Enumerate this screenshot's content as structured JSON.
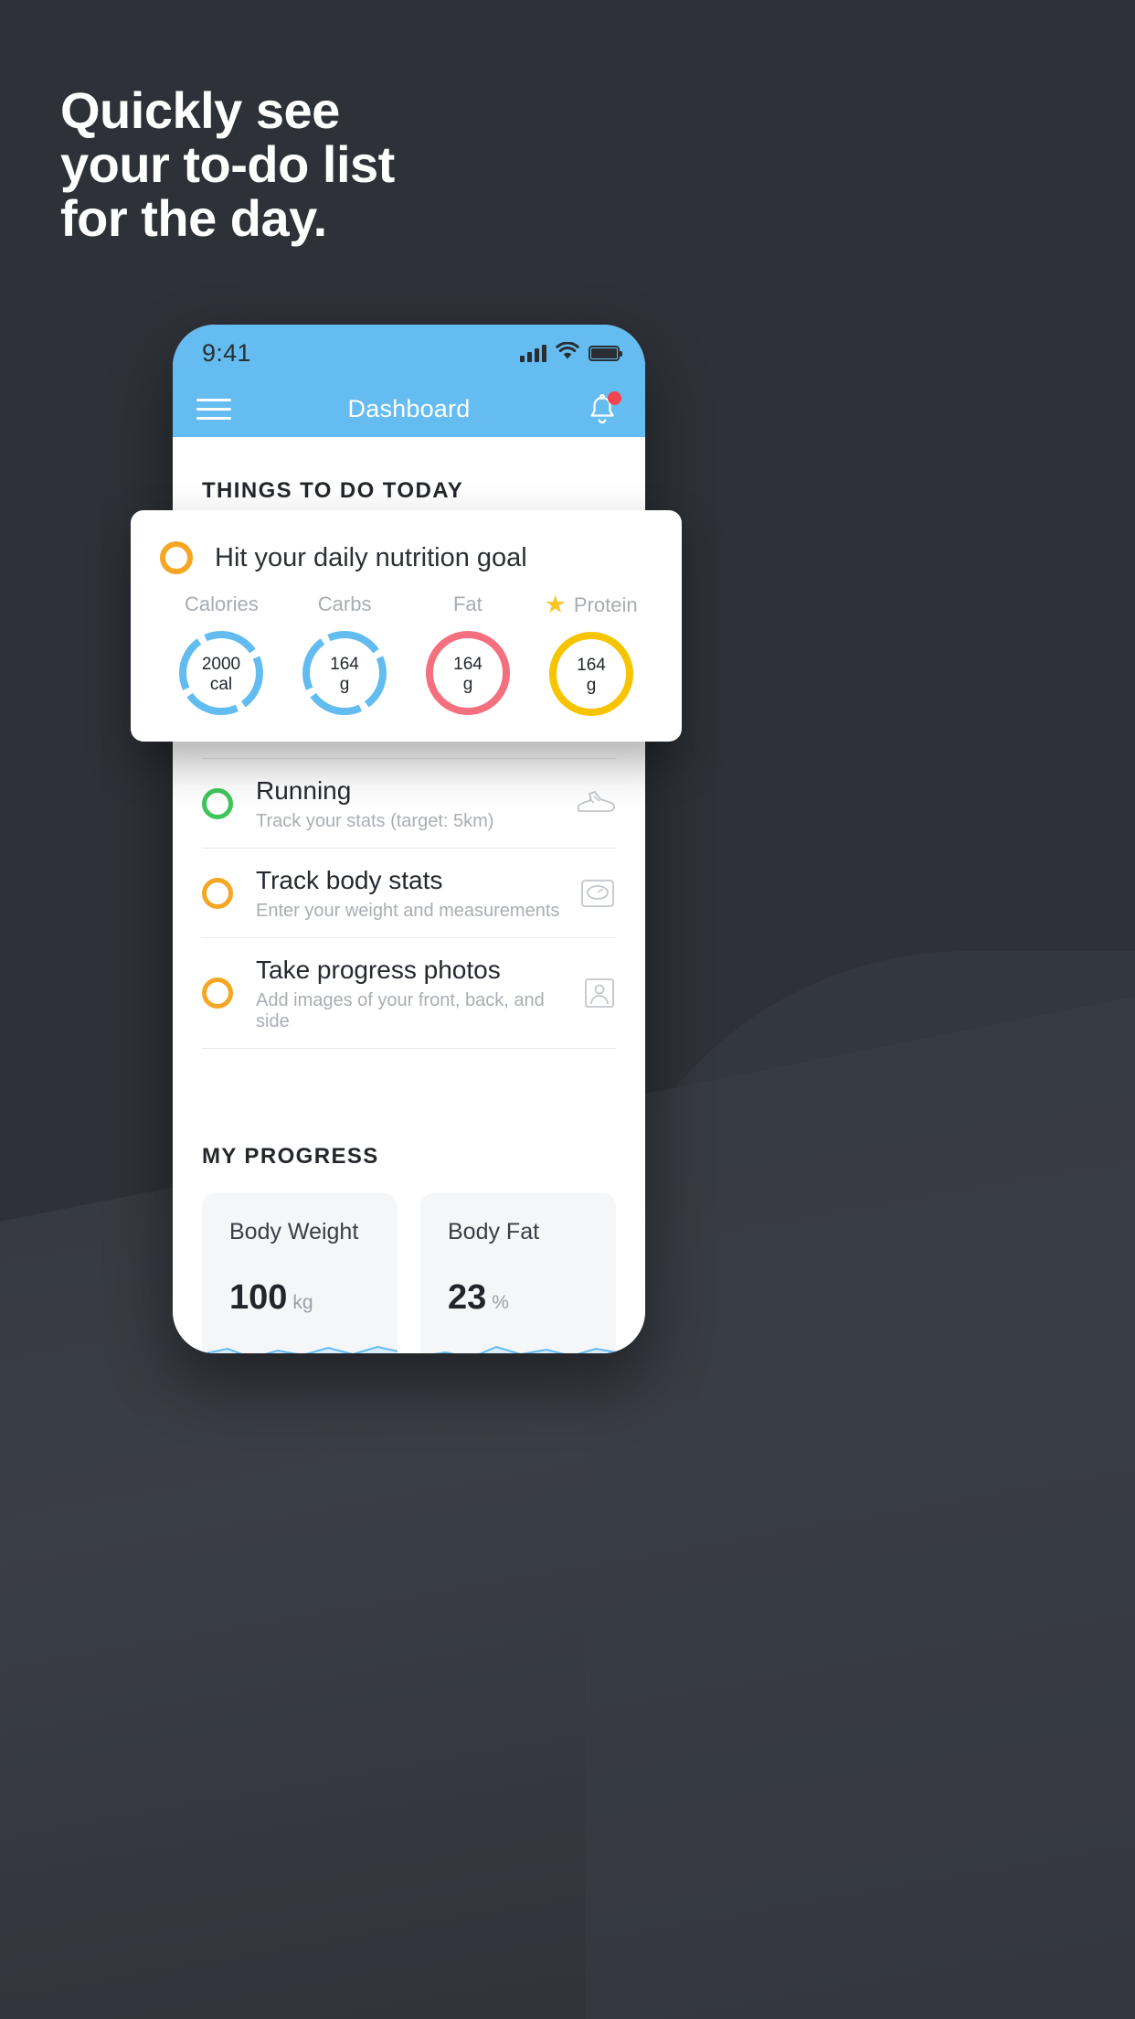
{
  "headline": {
    "line1": "Quickly see",
    "line2": "your to-do list",
    "line3": "for the day."
  },
  "colors": {
    "background": "#2e3238",
    "accent_blue": "#65bcf0",
    "ring_blue": "#62bcf0",
    "ring_red": "#f4707f",
    "ring_yellow": "#f6c400",
    "check_orange": "#f5a623",
    "check_green": "#3ec65a",
    "badge_red": "#f4444f"
  },
  "statusbar": {
    "time": "9:41",
    "signal_icon": "signal-bars-icon",
    "wifi_icon": "wifi-icon",
    "battery_icon": "battery-full-icon"
  },
  "navbar": {
    "menu_icon": "hamburger-menu-icon",
    "title": "Dashboard",
    "bell_icon": "bell-icon",
    "has_notification": true
  },
  "sections": {
    "todo_title": "THINGS TO DO TODAY",
    "progress_title": "MY PROGRESS"
  },
  "nutrition_card": {
    "checkbox_state": "incomplete",
    "title": "Hit your daily nutrition goal",
    "macros": [
      {
        "label": "Calories",
        "value": "2000",
        "unit": "cal",
        "color": "#62bcf0",
        "starred": false,
        "percent": 82
      },
      {
        "label": "Carbs",
        "value": "164",
        "unit": "g",
        "color": "#62bcf0",
        "starred": false,
        "percent": 82
      },
      {
        "label": "Fat",
        "value": "164",
        "unit": "g",
        "color": "#f4707f",
        "starred": false,
        "percent": 100
      },
      {
        "label": "Protein",
        "value": "164",
        "unit": "g",
        "color": "#f6c400",
        "starred": true,
        "percent": 100
      }
    ]
  },
  "tasks": [
    {
      "title": "Running",
      "subtitle": "Track your stats (target: 5km)",
      "ring_color": "green",
      "icon": "running-shoe-icon"
    },
    {
      "title": "Track body stats",
      "subtitle": "Enter your weight and measurements",
      "ring_color": "orange",
      "icon": "weight-scale-icon"
    },
    {
      "title": "Take progress photos",
      "subtitle": "Add images of your front, back, and side",
      "ring_color": "orange",
      "icon": "photo-person-icon"
    }
  ],
  "progress_cards": [
    {
      "label": "Body Weight",
      "value": "100",
      "unit": "kg"
    },
    {
      "label": "Body Fat",
      "value": "23",
      "unit": "%"
    }
  ]
}
